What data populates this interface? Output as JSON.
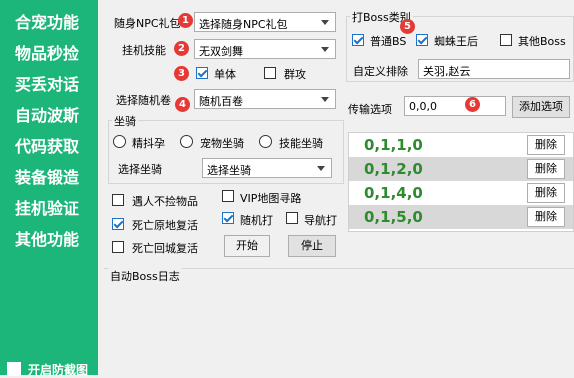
{
  "sidebar": {
    "items": [
      "合宠功能",
      "物品秒捡",
      "买丢对话",
      "自动波斯",
      "代码获取",
      "装备锻造",
      "挂机验证",
      "其他功能"
    ],
    "bottom_checkbox_label": "开启防截图"
  },
  "left_panel": {
    "npc_label": "随身NPC礼包",
    "npc_select": "选择随身NPC礼包",
    "skill_label": "挂机技能",
    "skill_select": "无双剑舞",
    "single_label": "单体",
    "group_label": "群攻",
    "scroll_label": "选择随机卷",
    "scroll_select": "随机百卷",
    "mount_group_title": "坐骑",
    "mount_radio_1": "精抖孕",
    "mount_radio_2": "宠物坐骑",
    "mount_radio_3": "技能坐骑",
    "mount_label": "选择坐骑",
    "mount_select": "选择坐骑",
    "opt_no_pickup": "遇人不捡物品",
    "opt_vip": "VIP地图寻路",
    "opt_revive_here": "死亡原地复活",
    "opt_random_hit": "随机打",
    "opt_nav_hit": "导航打",
    "opt_revive_city": "死亡回城复活",
    "start_button": "开始",
    "stop_button": "停止"
  },
  "boss_panel": {
    "title": "打Boss类别",
    "normal_label": "普通BS",
    "spider_label": "蜘蛛王后",
    "other_label": "其他Boss",
    "exclude_label": "自定义排除",
    "exclude_value": "关羽,赵云",
    "transfer_label": "传输选项",
    "transfer_value": "0,0,0",
    "add_button": "添加选项",
    "delete_label": "删除",
    "rows": [
      "0,1,1,0",
      "0,1,2,0",
      "0,1,4,0",
      "0,1,5,0"
    ]
  },
  "log": {
    "title": "自动Boss日志"
  },
  "badges": [
    "1",
    "2",
    "3",
    "4",
    "5",
    "6"
  ],
  "colors": {
    "sidebar": "#1db67a",
    "badge": "#e53935",
    "row_value": "#2e8b2e",
    "check": "#1e73c8"
  }
}
